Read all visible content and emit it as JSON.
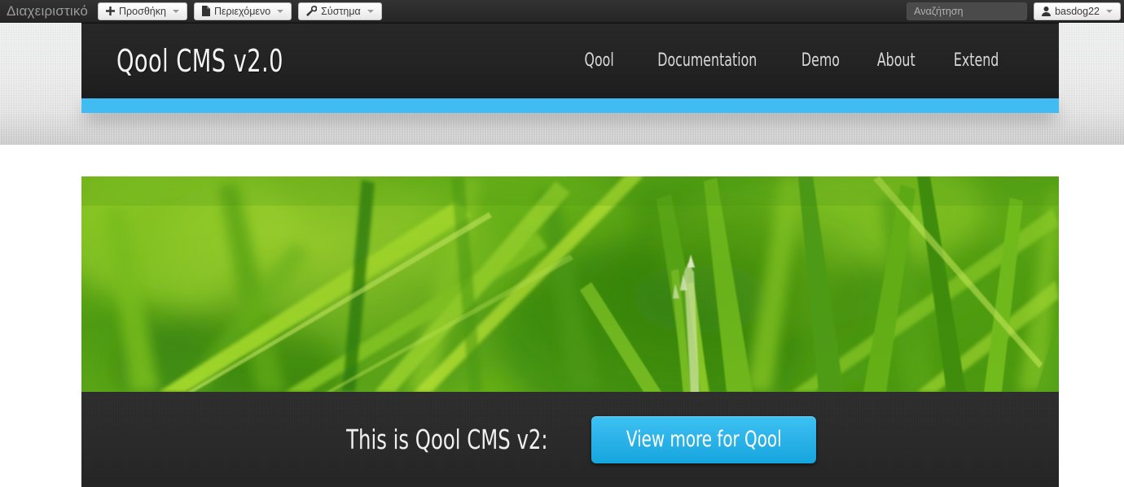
{
  "admin_bar": {
    "brand": "Διαχειριστικό",
    "buttons": [
      {
        "label": "Προσθήκη",
        "icon": "plus-icon"
      },
      {
        "label": "Περιεχόμενο",
        "icon": "file-icon"
      },
      {
        "label": "Σύστημα",
        "icon": "wrench-icon"
      }
    ],
    "search": {
      "placeholder": "Αναζήτηση",
      "value": ""
    },
    "user": {
      "name": "basdog22",
      "icon": "user-icon"
    }
  },
  "site_header": {
    "title": "Qool CMS v2.0",
    "nav": [
      {
        "label": "Qool"
      },
      {
        "label": "Documentation"
      },
      {
        "label": "Demo"
      },
      {
        "label": "About"
      },
      {
        "label": "Extend"
      }
    ]
  },
  "hero": {
    "image_alt": "close-up photo of green grass blades",
    "caption_text": "This is Qool CMS v2:",
    "cta_label": "View more for Qool"
  },
  "colors": {
    "accent_blue": "#41bcf2",
    "cta_blue_top": "#3cc2f2",
    "cta_blue_bottom": "#16a5de",
    "header_dark": "#232323",
    "admin_bar_dark": "#2b2b2b",
    "caption_dark": "#2a2a2a",
    "page_background": "#ffffff"
  }
}
